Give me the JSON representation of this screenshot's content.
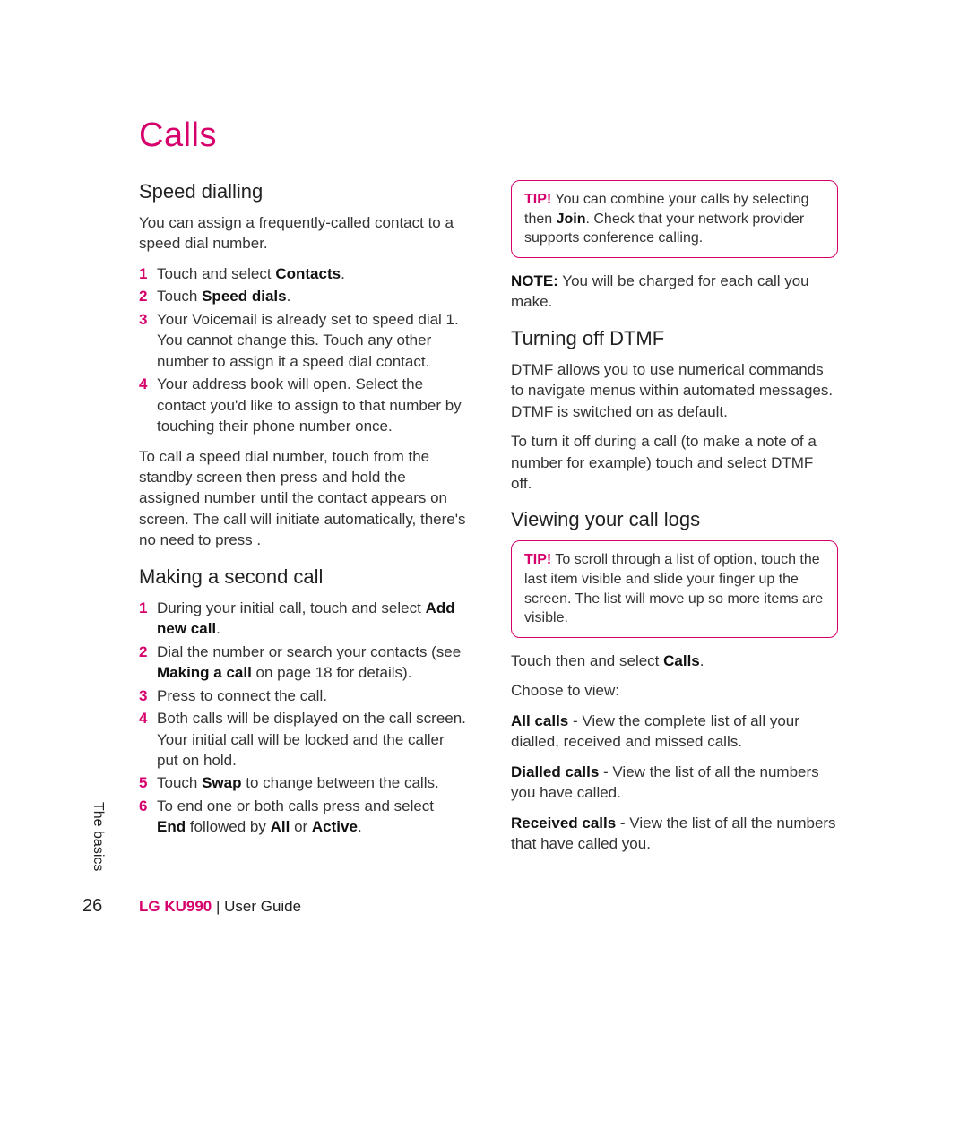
{
  "page_title": "Calls",
  "side_label": "The basics",
  "page_number": "26",
  "footer": {
    "brand": "LG KU990",
    "rest": "  |  User Guide"
  },
  "left": {
    "sec1": {
      "title": "Speed dialling",
      "intro": "You can assign a frequently-called contact to a speed dial number.",
      "steps": [
        {
          "n": "1",
          "pre": "Touch ",
          "bold": "",
          "mid": " and select ",
          "bold2": "Contacts",
          "post": "."
        },
        {
          "n": "2",
          "pre": "Touch ",
          "bold": "Speed dials",
          "post": "."
        },
        {
          "n": "3",
          "pre": "Your Voicemail is already set to speed dial 1. You cannot change this. Touch any other number to assign it a speed dial contact."
        },
        {
          "n": "4",
          "pre": "Your address book will open. Select the contact you'd like to assign to that number by touching their phone number once."
        }
      ],
      "after": "To call a speed dial number, touch      from the standby screen then press and hold the assigned number until the contact appears on screen. The call will initiate automatically, there's no need to press      ."
    },
    "sec2": {
      "title": "Making a second call",
      "steps": [
        {
          "n": "1",
          "pre": "During your initial call, touch ",
          "mid": " and select ",
          "bold2": "Add new call",
          "post": "."
        },
        {
          "n": "2",
          "pre": "Dial the number or search your contacts (see ",
          "bold": "Making a call",
          "post": " on page 18 for details)."
        },
        {
          "n": "3",
          "pre": "Press ",
          "post": " to connect the call."
        },
        {
          "n": "4",
          "pre": "Both calls will be displayed on the call screen. Your initial call will be locked and the caller put on hold."
        },
        {
          "n": "5",
          "pre": "Touch ",
          "bold": "Swap",
          "post": " to change between the calls."
        },
        {
          "n": "6",
          "pre": "To end one or both calls press ",
          "mid": " and select ",
          "bold2": "End",
          "mid2": " followed by ",
          "bold3": "All",
          "mid3": " or ",
          "bold4": "Active",
          "post": "."
        }
      ]
    }
  },
  "right": {
    "tip1": {
      "label": "TIP!",
      "text": " You can combine your calls by selecting      then ",
      "bold": "Join",
      "post": ". Check that your network provider supports conference calling."
    },
    "note": {
      "label": "NOTE:",
      "text": " You will be charged for each call you make."
    },
    "sec1": {
      "title": "Turning off DTMF",
      "p1": "DTMF allows you to use numerical commands to navigate menus within automated messages. DTMF is switched on as default.",
      "p2": "To turn it off during a call (to make a note of a number for example) touch      and select DTMF off."
    },
    "sec2": {
      "title": "Viewing your call logs",
      "tip": {
        "label": "TIP!",
        "text": " To scroll through a list of option, touch the last item visible and slide your finger up the screen. The list will move up so more items are visible."
      },
      "p1_pre": "Touch      then      and select ",
      "p1_bold": "Calls",
      "p1_post": ".",
      "p2": "Choose to view:",
      "items": [
        {
          "bold": "All calls",
          "text": " - View the complete list of all your dialled, received and missed calls."
        },
        {
          "bold": "Dialled calls",
          "text": " - View the list of all the numbers you have called."
        },
        {
          "bold": "Received calls",
          "text": " - View the list of all the numbers that have called you."
        }
      ]
    }
  }
}
